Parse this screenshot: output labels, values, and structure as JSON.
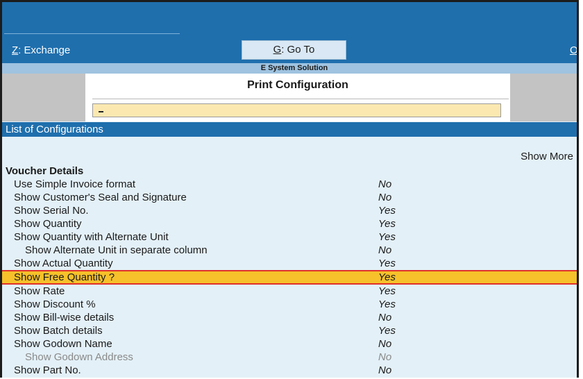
{
  "toolbar": {
    "exchange": {
      "key": "Z",
      "label": ": Exchange"
    },
    "goto": {
      "key": "G",
      "label": ": Go To"
    },
    "more": {
      "key": "O",
      "label": ":"
    }
  },
  "company_name": "E System Solution",
  "dialog": {
    "title": "Print Configuration",
    "search_value": ""
  },
  "list_header": "List of Configurations",
  "show_more": "Show More",
  "section": "Voucher Details",
  "items": [
    {
      "label": "Use Simple Invoice format",
      "value": "No",
      "indent": false,
      "dim": false,
      "selected": false
    },
    {
      "label": "Show Customer's Seal and Signature",
      "value": "No",
      "indent": false,
      "dim": false,
      "selected": false
    },
    {
      "label": "Show Serial No.",
      "value": "Yes",
      "indent": false,
      "dim": false,
      "selected": false
    },
    {
      "label": "Show Quantity",
      "value": "Yes",
      "indent": false,
      "dim": false,
      "selected": false
    },
    {
      "label": "Show Quantity with Alternate Unit",
      "value": "Yes",
      "indent": false,
      "dim": false,
      "selected": false
    },
    {
      "label": "Show Alternate Unit in separate column",
      "value": "No",
      "indent": true,
      "dim": false,
      "selected": false
    },
    {
      "label": "Show Actual Quantity",
      "value": "Yes",
      "indent": false,
      "dim": false,
      "selected": false
    },
    {
      "label": "Show Free Quantity ?",
      "value": "Yes",
      "indent": false,
      "dim": false,
      "selected": true
    },
    {
      "label": "Show Rate",
      "value": "Yes",
      "indent": false,
      "dim": false,
      "selected": false
    },
    {
      "label": "Show Discount %",
      "value": "Yes",
      "indent": false,
      "dim": false,
      "selected": false
    },
    {
      "label": "Show Bill-wise details",
      "value": "No",
      "indent": false,
      "dim": false,
      "selected": false
    },
    {
      "label": "Show Batch details",
      "value": "Yes",
      "indent": false,
      "dim": false,
      "selected": false
    },
    {
      "label": "Show Godown Name",
      "value": "No",
      "indent": false,
      "dim": false,
      "selected": false
    },
    {
      "label": "Show Godown Address",
      "value": "No",
      "indent": true,
      "dim": true,
      "selected": false
    },
    {
      "label": "Show Part No.",
      "value": "No",
      "indent": false,
      "dim": false,
      "selected": false
    }
  ],
  "colors": {
    "bar": "#1f6fad",
    "highlight": "#f6c12a",
    "highlight_border": "#e0302b",
    "input_bg": "#fbe8b0"
  }
}
